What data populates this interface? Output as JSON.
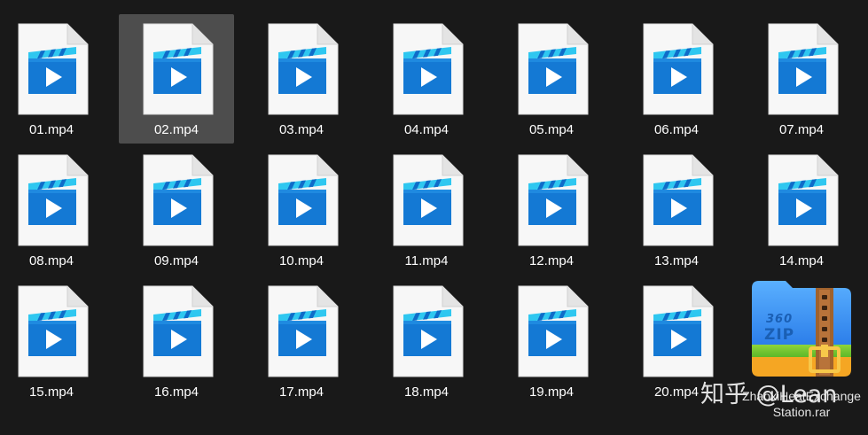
{
  "files": [
    {
      "name": "01.mp4",
      "selected": false
    },
    {
      "name": "02.mp4",
      "selected": true
    },
    {
      "name": "03.mp4",
      "selected": false
    },
    {
      "name": "04.mp4",
      "selected": false
    },
    {
      "name": "05.mp4",
      "selected": false
    },
    {
      "name": "06.mp4",
      "selected": false
    },
    {
      "name": "07.mp4",
      "selected": false
    },
    {
      "name": "08.mp4",
      "selected": false
    },
    {
      "name": "09.mp4",
      "selected": false
    },
    {
      "name": "10.mp4",
      "selected": false
    },
    {
      "name": "11.mp4",
      "selected": false
    },
    {
      "name": "12.mp4",
      "selected": false
    },
    {
      "name": "13.mp4",
      "selected": false
    },
    {
      "name": "14.mp4",
      "selected": false
    },
    {
      "name": "15.mp4",
      "selected": false
    },
    {
      "name": "16.mp4",
      "selected": false
    },
    {
      "name": "17.mp4",
      "selected": false
    },
    {
      "name": "18.mp4",
      "selected": false
    },
    {
      "name": "19.mp4",
      "selected": false
    },
    {
      "name": "20.mp4",
      "selected": false
    }
  ],
  "file_icon": "video-file-icon",
  "archive": {
    "name": "ZhaoxiHeatExchangeStation.rar",
    "icon": "360zip-archive-icon",
    "icon_text": "ZIP",
    "icon_brand": "360"
  },
  "watermark": "知乎 @Lean",
  "colors": {
    "background": "#191919",
    "selection": "#4d4d4d",
    "video_blue": "#1479d4",
    "video_cyan": "#2fc7f0"
  }
}
